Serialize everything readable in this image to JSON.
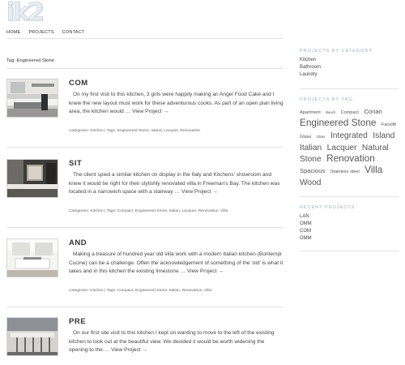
{
  "site": {
    "logo_text": "ik2"
  },
  "nav": {
    "items": [
      "HOME",
      "PROJECTS",
      "CONTACT"
    ]
  },
  "archive": {
    "title": "Tag: Engineered Stone"
  },
  "posts": [
    {
      "title": "COM",
      "excerpt": "On my first visit to this kitchen, 3 girls were happily making an Angel Food Cake and I knew the new layout must work for these adventurous cooks. As part of an open plan living area, the kitchen would …",
      "link": "View Project →",
      "categories_label": "Categories:",
      "categories": "Kitchen",
      "tags_label": "| Tags:",
      "tags": "Engineered Stone, Island, Lacquer, Renovation"
    },
    {
      "title": "SIT",
      "excerpt": "The client spied a similar kitchen on display in the Italy and Kitchens' showroom and knew it would be right for their stylishly renovated villa in Freeman's Bay. The kitchen was located in a narrowish space with a stairway …",
      "link": "View Project →",
      "categories_label": "Categories:",
      "categories": "Kitchen",
      "tags_label": "| Tags:",
      "tags": "Compact, Engineered Stone, Italian, Lacquer, Renovation, Villa"
    },
    {
      "title": "AND",
      "excerpt": "Making a treasure of hundred year old villa work with a modern Italian kitchen (Bontempi Cucine) can be a challenge. Often the acknowledgement of something of the 'old' is what it takes and in this kitchen the existing limestone …",
      "link": "View Project →",
      "categories_label": "Categories:",
      "categories": "Kitchen",
      "tags_label": "| Tags:",
      "tags": "Compact, Engineered Stone, Italian, Renovation, Villa"
    },
    {
      "title": "PRE",
      "excerpt": "On our first site visit to this kitchen I kept on wanting to move to the left of the existing kitchen to look out at the beautiful view. We decided it would be worth widening the opening to the …",
      "link": "View Project →"
    }
  ],
  "sidebar": {
    "categories_heading": "PROJECTS BY CATEGORY",
    "categories": [
      "Kitchen",
      "Bathroom",
      "Laundry"
    ],
    "tags_heading": "PROJECTS BY TAG:",
    "tags": [
      {
        "label": "Apartment",
        "size": 1
      },
      {
        "label": "Beach",
        "size": 0
      },
      {
        "label": "Compact",
        "size": 1
      },
      {
        "label": "Corian",
        "size": 2
      },
      {
        "label": "Engineered Stone",
        "size": 4
      },
      {
        "label": "Facelift",
        "size": 1
      },
      {
        "label": "Glass",
        "size": 1
      },
      {
        "label": "Gloss",
        "size": 0
      },
      {
        "label": "Integrated",
        "size": 3
      },
      {
        "label": "Island",
        "size": 3
      },
      {
        "label": "Italian",
        "size": 3
      },
      {
        "label": "Lacquer",
        "size": 3
      },
      {
        "label": "Natural",
        "size": 3
      },
      {
        "label": "Stone",
        "size": 3
      },
      {
        "label": "Renovation",
        "size": 4
      },
      {
        "label": "Spacious",
        "size": 2
      },
      {
        "label": "Stainless steel",
        "size": 1
      },
      {
        "label": "Villa",
        "size": 4
      },
      {
        "label": "Wood",
        "size": 3
      }
    ],
    "recent_heading": "RECENT PROJECTS",
    "recent": [
      "LAN",
      "OMM",
      "COM",
      "OMM"
    ]
  }
}
